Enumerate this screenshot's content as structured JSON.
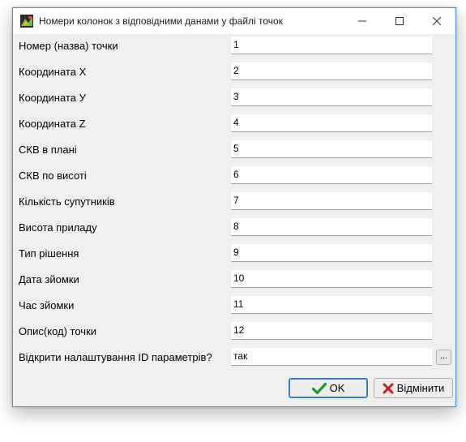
{
  "window": {
    "title": "Номери колонок з відповідними данами у файлі точок"
  },
  "fields": [
    {
      "label": "Номер (назва) точки",
      "value": "1"
    },
    {
      "label": "Координата X",
      "value": "2"
    },
    {
      "label": "Координата У",
      "value": "3"
    },
    {
      "label": "Координата Z",
      "value": "4"
    },
    {
      "label": "СКВ в плані",
      "value": "5"
    },
    {
      "label": "СКВ по висоті",
      "value": "6"
    },
    {
      "label": "Кількість супутників",
      "value": "7"
    },
    {
      "label": "Висота приладу",
      "value": "8"
    },
    {
      "label": "Тип рішення",
      "value": "9"
    },
    {
      "label": "Дата зйомки",
      "value": "10"
    },
    {
      "label": "Час зйомки",
      "value": "11"
    },
    {
      "label": "Опис(код) точки",
      "value": "12"
    },
    {
      "label": "Відкрити налаштування ID параметрів?",
      "value": "так"
    }
  ],
  "ellipsis_label": "...",
  "buttons": {
    "ok_label": "OK",
    "cancel_label": "Відмінити"
  },
  "colors": {
    "window_border": "#4a90d9",
    "dialog_bg": "#f0f0f0",
    "ok_check": "#1e9a2e",
    "cancel_x": "#c8201e"
  },
  "icons": {
    "app": "app-icon",
    "minimize": "minimize-icon",
    "maximize": "maximize-icon",
    "close": "close-icon",
    "ok": "checkmark-icon",
    "cancel": "x-mark-icon"
  }
}
